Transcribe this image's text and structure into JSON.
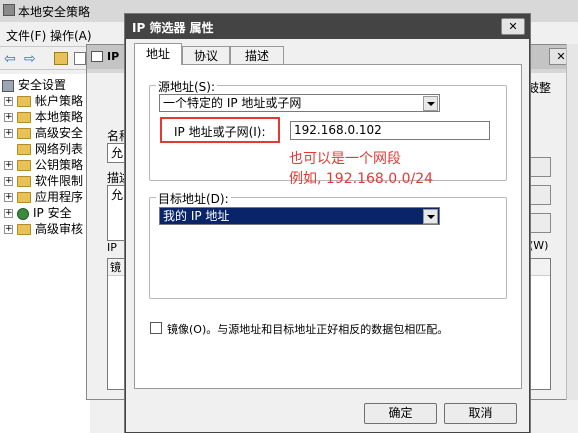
{
  "main_window": {
    "title": "本地安全策略",
    "menu": [
      "文件(F)",
      "操作(A)"
    ],
    "tree": [
      {
        "label": "安全设置",
        "root": true
      },
      {
        "label": "帐户策略"
      },
      {
        "label": "本地策略"
      },
      {
        "label": "高级安全"
      },
      {
        "label": "网络列表"
      },
      {
        "label": "公钥策略"
      },
      {
        "label": "软件限制"
      },
      {
        "label": "应用程序"
      },
      {
        "label": "IP 安全"
      },
      {
        "label": "高级审核"
      }
    ]
  },
  "bg_window": {
    "title_fragment": "IP",
    "name_label": "名称",
    "name_value": "允",
    "desc_label": "描述",
    "desc_value": "允",
    "list_label": "IP",
    "list_header": "镜",
    "right_label": "鼓",
    "right_tail": "整",
    "key_hint": "(W)"
  },
  "dialog": {
    "title": "IP 筛选器 属性",
    "tabs": [
      "地址",
      "协议",
      "描述"
    ],
    "source": {
      "group_label": "源地址(S):",
      "selected": "一个特定的 IP 地址或子网",
      "ip_label": "IP 地址或子网(I):",
      "ip_value": "192.168.0.102"
    },
    "annotation": [
      "也可以是一个网段",
      "例如, 192.168.0.0/24"
    ],
    "dest": {
      "group_label": "目标地址(D):",
      "selected": "我的 IP 地址"
    },
    "mirror_label": "镜像(O)。与源地址和目标地址正好相反的数据包相匹配。",
    "ok": "确定",
    "cancel": "取消"
  },
  "colors": {
    "annotation_red": "#e53935",
    "selection_blue": "#0a246a",
    "titlebar_dark": "#444444"
  }
}
